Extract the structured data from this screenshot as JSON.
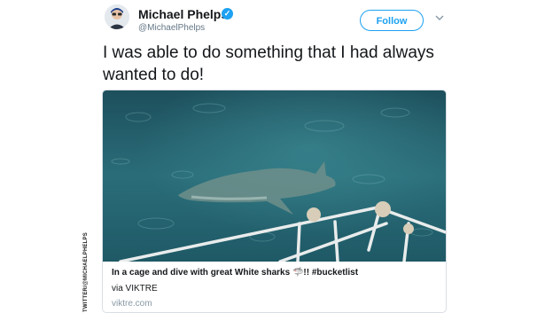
{
  "photo_credit": "TWITTER/@MICHAELPHELPS",
  "user": {
    "name": "Michael Phelps",
    "handle": "@MichaelPhelps",
    "verified_icon": "verified-badge-icon"
  },
  "follow_label": "Follow",
  "tweet_text": "I was able to do something that I had always wanted to do!",
  "card": {
    "title": "In a cage and dive with great White sharks 🦈!! #bucketlist",
    "via": "via VIKTRE",
    "domain": "viktre.com"
  },
  "colors": {
    "accent": "#1da1f2",
    "text": "#14171a",
    "muted": "#657786",
    "water": "#24626f"
  }
}
